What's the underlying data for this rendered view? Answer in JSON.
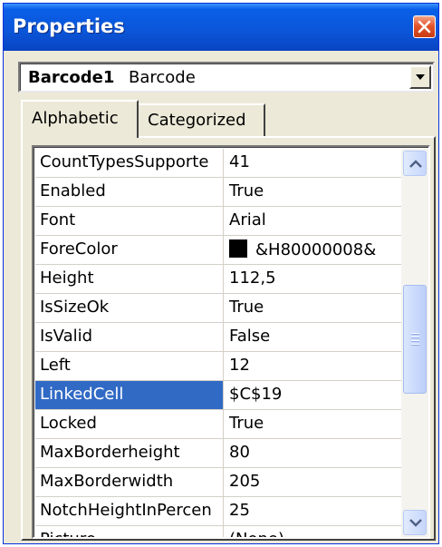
{
  "window": {
    "title": "Properties"
  },
  "object_selector": {
    "name": "Barcode1",
    "type": "Barcode"
  },
  "tabs": [
    {
      "label": "Alphabetic",
      "active": true
    },
    {
      "label": "Categorized",
      "active": false
    }
  ],
  "properties": [
    {
      "name": "CountTypesSupporte",
      "value": "41"
    },
    {
      "name": "Enabled",
      "value": "True"
    },
    {
      "name": "Font",
      "value": "Arial"
    },
    {
      "name": "ForeColor",
      "value": "&H80000008&",
      "swatch": "#000000"
    },
    {
      "name": "Height",
      "value": "112,5"
    },
    {
      "name": "IsSizeOk",
      "value": "True"
    },
    {
      "name": "IsValid",
      "value": "False"
    },
    {
      "name": "Left",
      "value": "12"
    },
    {
      "name": "LinkedCell",
      "value": "$C$19",
      "selected": true
    },
    {
      "name": "Locked",
      "value": "True"
    },
    {
      "name": "MaxBorderheight",
      "value": "80"
    },
    {
      "name": "MaxBorderwidth",
      "value": "205"
    },
    {
      "name": "NotchHeightInPercen",
      "value": "25"
    },
    {
      "name": "Picture",
      "value": "(None)"
    }
  ],
  "colors": {
    "titlebar": "#0b55d8",
    "selection": "#316ac5",
    "close_button": "#e2562c"
  }
}
